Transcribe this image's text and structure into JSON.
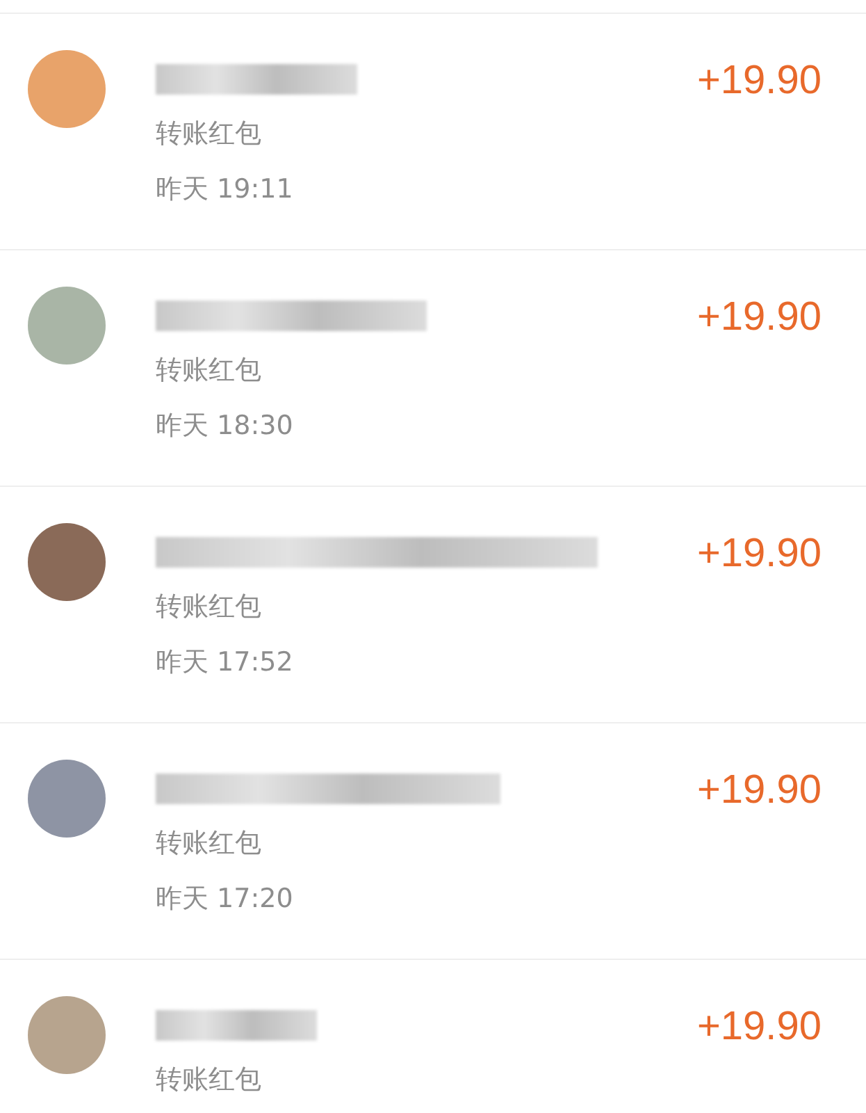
{
  "transactions": [
    {
      "type": "转账红包",
      "time": "昨天 19:11",
      "amount": "+19.90"
    },
    {
      "type": "转账红包",
      "time": "昨天 18:30",
      "amount": "+19.90"
    },
    {
      "type": "转账红包",
      "time": "昨天 17:52",
      "amount": "+19.90"
    },
    {
      "type": "转账红包",
      "time": "昨天 17:20",
      "amount": "+19.90"
    },
    {
      "type": "转账红包",
      "amount": "+19.90"
    }
  ]
}
